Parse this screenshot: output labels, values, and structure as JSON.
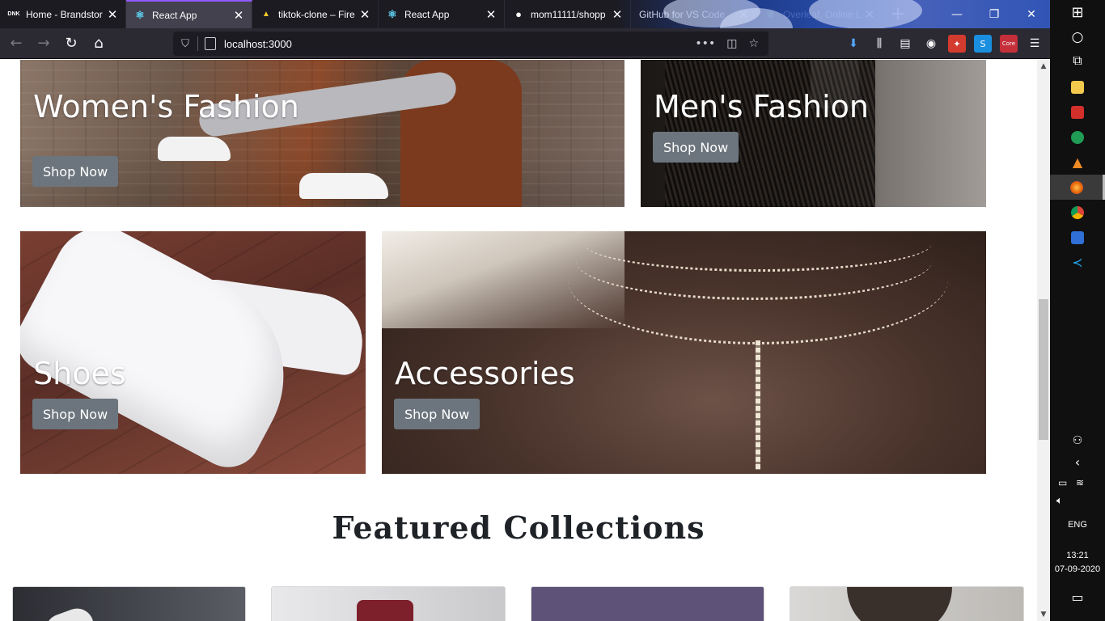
{
  "browser": {
    "tabs": [
      {
        "title": "Home - Brandstor",
        "icon": "brandstore-icon",
        "favicon_text": "DNK",
        "active": false
      },
      {
        "title": "React App",
        "icon": "react-icon",
        "favicon_text": "⚛",
        "active": true
      },
      {
        "title": "tiktok-clone – Fire",
        "icon": "firebase-icon",
        "favicon_text": "▲",
        "active": false
      },
      {
        "title": "React App",
        "icon": "react-icon",
        "favicon_text": "⚛",
        "active": false
      },
      {
        "title": "mom11111/shopp",
        "icon": "github-icon",
        "favicon_text": "●",
        "active": false
      },
      {
        "title": "GitHub for VS Code",
        "icon": "",
        "favicon_text": "",
        "active": false
      },
      {
        "title": "Overleaf, Online L",
        "icon": "overleaf-icon",
        "favicon_text": "❦",
        "active": false
      }
    ],
    "close_glyph": "✕",
    "new_tab_glyph": "+",
    "url": "localhost:3000",
    "window_controls": {
      "minimize": "—",
      "restore": "❐",
      "close": "✕"
    }
  },
  "page": {
    "categories": [
      {
        "label": "Women's Fashion",
        "button": "Shop Now"
      },
      {
        "label": "Men's Fashion",
        "button": "Shop Now"
      },
      {
        "label": "Shoes",
        "button": "Shop Now"
      },
      {
        "label": "Accessories",
        "button": "Shop Now"
      }
    ],
    "featured_title": "Featured Collections"
  },
  "taskbar": {
    "language": "ENG",
    "time": "13:21",
    "date": "07-09-2020"
  },
  "colors": {
    "tab_bar": "#1c1b22",
    "active_tab": "#42414d",
    "nav_bar": "#2b2a33",
    "shop_button": "#6c757d",
    "taskbar": "#101010"
  }
}
